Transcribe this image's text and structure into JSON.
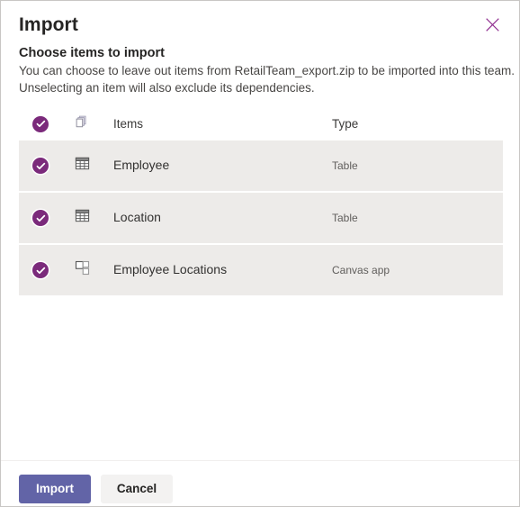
{
  "dialog": {
    "title": "Import",
    "close_label": "Close",
    "close_icon": "close-icon",
    "subtitle": "Choose items to import",
    "description_line1": "You can choose to leave out items from RetailTeam_export.zip to be imported into this team.",
    "description_line2": "Unselecting an item will also exclude its dependencies.",
    "package_name": "RetailTeam_export.zip"
  },
  "list": {
    "header": {
      "select_all_icon": "check-circle-icon",
      "type_glyph_icon": "copy-pages-icon",
      "items_label": "Items",
      "type_label": "Type"
    },
    "rows": [
      {
        "selected": true,
        "check_icon": "check-circle-icon",
        "icon": "table-icon",
        "name": "Employee",
        "type": "Table"
      },
      {
        "selected": true,
        "check_icon": "check-circle-icon",
        "icon": "table-icon",
        "name": "Location",
        "type": "Table"
      },
      {
        "selected": true,
        "check_icon": "check-circle-icon",
        "icon": "canvas-app-icon",
        "name": "Employee Locations",
        "type": "Canvas app"
      }
    ]
  },
  "footer": {
    "import_label": "Import",
    "cancel_label": "Cancel"
  },
  "colors": {
    "accent_primary": "#6264a7",
    "check_purple": "#7B2A7B",
    "close_icon": "#8F2D8F",
    "row_background": "#edebe9",
    "dialog_border": "#c8c6c4",
    "text_primary": "#252423",
    "text_secondary": "#605e5c"
  }
}
